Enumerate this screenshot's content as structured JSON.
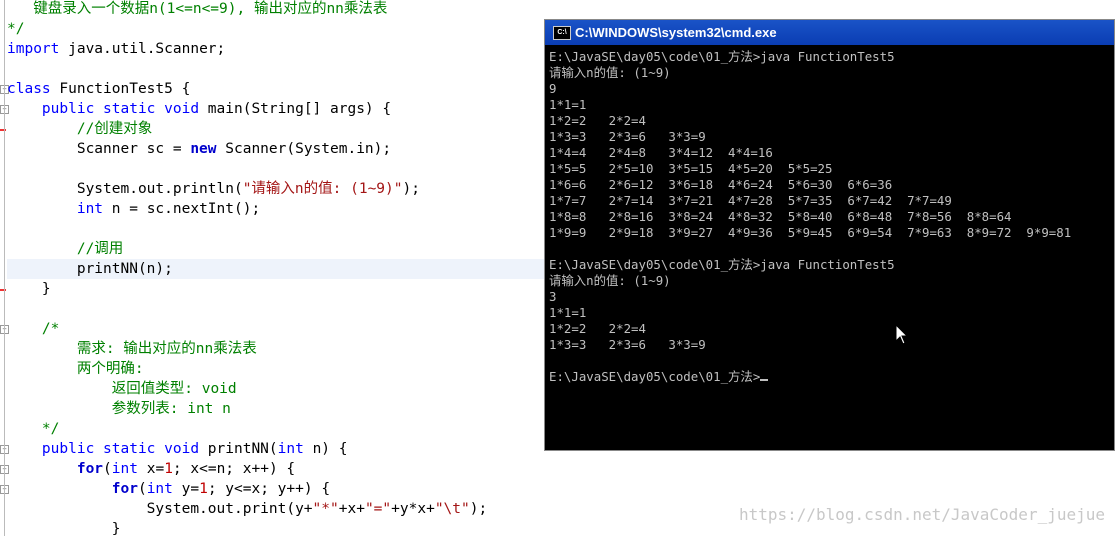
{
  "editor": {
    "lines": [
      {
        "tokens": [
          [
            "c",
            "   键盘录入一个数据n(1<=n<=9), 输出对应的nn乘法表"
          ]
        ]
      },
      {
        "tokens": [
          [
            "c",
            "*/"
          ]
        ]
      },
      {
        "tokens": [
          [
            "k",
            "import"
          ],
          [
            "t",
            " java.util.Scanner;"
          ]
        ]
      },
      {
        "tokens": [
          [
            "t",
            ""
          ]
        ]
      },
      {
        "tokens": [
          [
            "k",
            "class"
          ],
          [
            "t",
            " FunctionTest5 {"
          ]
        ]
      },
      {
        "tokens": [
          [
            "t",
            "    "
          ],
          [
            "k",
            "public static void"
          ],
          [
            "t",
            " main(String[] args) {"
          ]
        ]
      },
      {
        "tokens": [
          [
            "t",
            "        "
          ],
          [
            "c",
            "//创建对象"
          ]
        ]
      },
      {
        "tokens": [
          [
            "t",
            "        Scanner sc = "
          ],
          [
            "kb",
            "new"
          ],
          [
            "t",
            " Scanner(System.in);"
          ]
        ]
      },
      {
        "tokens": [
          [
            "t",
            ""
          ]
        ]
      },
      {
        "tokens": [
          [
            "t",
            "        System.out.println("
          ],
          [
            "s",
            "\"请输入n的值: (1~9)\""
          ],
          [
            "t",
            ");"
          ]
        ]
      },
      {
        "tokens": [
          [
            "t",
            "        "
          ],
          [
            "k",
            "int"
          ],
          [
            "t",
            " n = sc.nextInt();"
          ]
        ]
      },
      {
        "tokens": [
          [
            "t",
            ""
          ]
        ]
      },
      {
        "tokens": [
          [
            "t",
            "        "
          ],
          [
            "c",
            "//调用"
          ]
        ]
      },
      {
        "tokens": [
          [
            "t",
            "        printNN(n);"
          ]
        ],
        "current": true
      },
      {
        "tokens": [
          [
            "t",
            "    }"
          ]
        ]
      },
      {
        "tokens": [
          [
            "t",
            ""
          ]
        ]
      },
      {
        "tokens": [
          [
            "t",
            "    "
          ],
          [
            "c",
            "/*"
          ]
        ]
      },
      {
        "tokens": [
          [
            "t",
            "        "
          ],
          [
            "c",
            "需求: 输出对应的nn乘法表"
          ]
        ]
      },
      {
        "tokens": [
          [
            "t",
            "        "
          ],
          [
            "c",
            "两个明确:"
          ]
        ]
      },
      {
        "tokens": [
          [
            "t",
            "            "
          ],
          [
            "c",
            "返回值类型: void"
          ]
        ]
      },
      {
        "tokens": [
          [
            "t",
            "            "
          ],
          [
            "c",
            "参数列表: int n"
          ]
        ]
      },
      {
        "tokens": [
          [
            "t",
            "    "
          ],
          [
            "c",
            "*/"
          ]
        ]
      },
      {
        "tokens": [
          [
            "t",
            "    "
          ],
          [
            "k",
            "public static void"
          ],
          [
            "t",
            " printNN("
          ],
          [
            "k",
            "int"
          ],
          [
            "t",
            " n) {"
          ]
        ]
      },
      {
        "tokens": [
          [
            "t",
            "        "
          ],
          [
            "kb",
            "for"
          ],
          [
            "t",
            "("
          ],
          [
            "k",
            "int"
          ],
          [
            "t",
            " x="
          ],
          [
            "n",
            "1"
          ],
          [
            "t",
            "; x<=n; x++) {"
          ]
        ]
      },
      {
        "tokens": [
          [
            "t",
            "            "
          ],
          [
            "kb",
            "for"
          ],
          [
            "t",
            "("
          ],
          [
            "k",
            "int"
          ],
          [
            "t",
            " y="
          ],
          [
            "n",
            "1"
          ],
          [
            "t",
            "; y<=x; y++) {"
          ]
        ]
      },
      {
        "tokens": [
          [
            "t",
            "                System.out.print(y+"
          ],
          [
            "s",
            "\"*\""
          ],
          [
            "t",
            "+x+"
          ],
          [
            "s",
            "\"=\""
          ],
          [
            "t",
            "+y*x+"
          ],
          [
            "s",
            "\"\\t\""
          ],
          [
            "t",
            ");"
          ]
        ]
      },
      {
        "tokens": [
          [
            "t",
            "            }"
          ]
        ]
      }
    ]
  },
  "cmd": {
    "title": "C:\\WINDOWS\\system32\\cmd.exe",
    "icon_name": "cmd-icon",
    "lines": [
      "E:\\JavaSE\\day05\\code\\01_方法>java FunctionTest5",
      "请输入n的值: (1~9)",
      "9",
      "1*1=1",
      "1*2=2   2*2=4",
      "1*3=3   2*3=6   3*3=9",
      "1*4=4   2*4=8   3*4=12  4*4=16",
      "1*5=5   2*5=10  3*5=15  4*5=20  5*5=25",
      "1*6=6   2*6=12  3*6=18  4*6=24  5*6=30  6*6=36",
      "1*7=7   2*7=14  3*7=21  4*7=28  5*7=35  6*7=42  7*7=49",
      "1*8=8   2*8=16  3*8=24  4*8=32  5*8=40  6*8=48  7*8=56  8*8=64",
      "1*9=9   2*9=18  3*9=27  4*9=36  5*9=45  6*9=54  7*9=63  8*9=72  9*9=81",
      "",
      "E:\\JavaSE\\day05\\code\\01_方法>java FunctionTest5",
      "请输入n的值: (1~9)",
      "3",
      "1*1=1",
      "1*2=2   2*2=4",
      "1*3=3   2*3=6   3*3=9",
      "",
      "E:\\JavaSE\\day05\\code\\01_方法>"
    ]
  },
  "watermark": "https://blog.csdn.net/JavaCoder_juejue"
}
